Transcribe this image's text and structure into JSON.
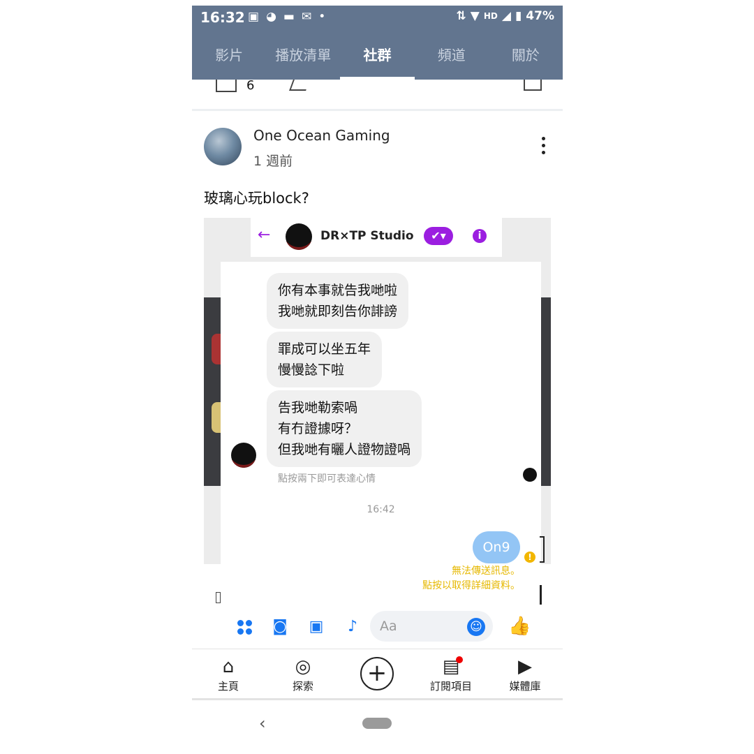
{
  "status_bar": {
    "time": "16:32",
    "network": "HD",
    "battery": "47%"
  },
  "tabs": [
    {
      "label": "影片"
    },
    {
      "label": "播放清單"
    },
    {
      "label": "社群"
    },
    {
      "label": "頻道"
    },
    {
      "label": "關於"
    }
  ],
  "prev_post": {
    "like_count": "6"
  },
  "post": {
    "channel_name": "One Ocean Gaming",
    "time_ago": "1 週前",
    "text": "玻璃心玩block?"
  },
  "messenger": {
    "contact_name": "DR×TP Studio",
    "messages": [
      {
        "lines": [
          "你有本事就告我哋啦",
          "我哋就即刻告你誹謗"
        ]
      },
      {
        "lines": [
          "罪成可以坐五年",
          "慢慢諗下啦"
        ]
      },
      {
        "lines": [
          "告我哋勒索喎",
          "有冇證據呀？",
          "但我哋有曬人證物證喎"
        ]
      }
    ],
    "reaction_hint": "點按兩下即可表達心情",
    "timestamp": "16:42",
    "my_message": "On9",
    "error_line1": "無法傳送訊息。",
    "error_line2": "點按以取得詳細資料。",
    "input_placeholder": "Aa"
  },
  "bottom_nav": [
    {
      "label": "主頁"
    },
    {
      "label": "探索"
    },
    {
      "label": "訂閱項目"
    },
    {
      "label": "媒體庫"
    }
  ],
  "colors": {
    "header_bg": "#62758f",
    "messenger_accent": "#9b1ee0",
    "sent_bubble": "#93c5f5",
    "error_text": "#e6b800",
    "action_blue": "#1877f2"
  }
}
